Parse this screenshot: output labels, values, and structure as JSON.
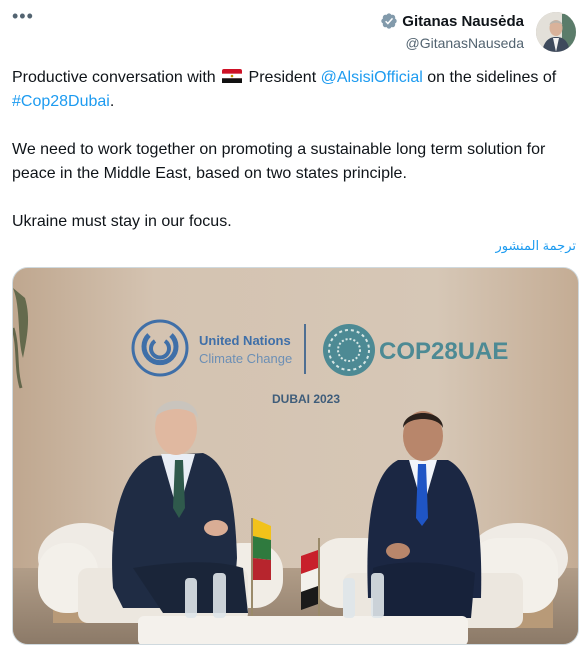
{
  "header": {
    "more_label": "•••",
    "author_name": "Gitanas Nausėda",
    "author_handle": "@GitanasNauseda"
  },
  "tweet": {
    "p1_a": "Productive conversation with ",
    "p1_b": " President ",
    "mention": "@AlsisiOfficial",
    "p1_c": " on the sidelines of ",
    "hashtag": "#Cop28Dubai",
    "p1_d": ".",
    "p2": "We need to work together on promoting a sustainable long term solution for peace in the Middle East, based on two states principle.",
    "p3": "Ukraine must stay in our focus.",
    "translate_label": "ترجمة المنشور"
  },
  "photo": {
    "un_line1": "United Nations",
    "un_line2": "Climate Change",
    "cop_label": "COP28UAE",
    "dubai_label": "DUBAI 2023"
  },
  "colors": {
    "link": "#1d9bf0",
    "secondary_text": "#536471"
  }
}
